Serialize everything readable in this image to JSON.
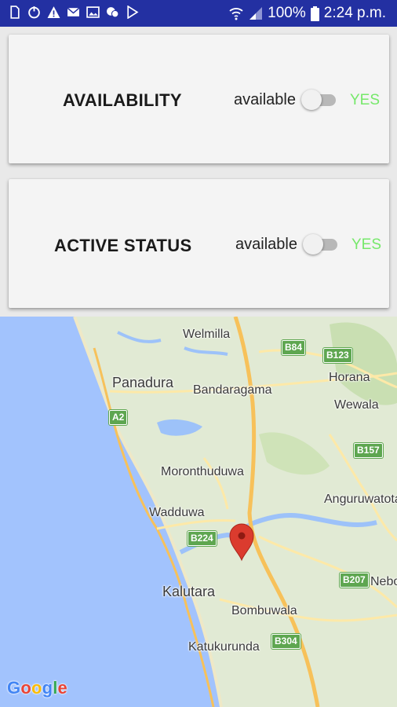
{
  "status_bar": {
    "icons": [
      "sim-card-icon",
      "power-clock-icon",
      "warning-icon",
      "mail-icon",
      "image-icon",
      "chat-icon",
      "play-store-icon"
    ],
    "battery_text": "100%",
    "time": "2:24 p.m.",
    "color": "#2330a2"
  },
  "cards": [
    {
      "title": "AVAILABILITY",
      "switch_label": "available",
      "value": "YES",
      "switch_on": false
    },
    {
      "title": "ACTIVE STATUS",
      "switch_label": "available",
      "value": "YES",
      "switch_on": false
    }
  ],
  "map": {
    "places": [
      "Welmilla",
      "Panadura",
      "Bandaragama",
      "Horana",
      "Wewala",
      "Moronthuduwa",
      "Anguruwatota",
      "Wadduwa",
      "Kalutara",
      "Bombuwala",
      "Katukurunda",
      "Nebo"
    ],
    "shields": [
      "B84",
      "B123",
      "A2",
      "B157",
      "B224",
      "B207",
      "B304"
    ],
    "attribution": "Google",
    "marker": "map-pin-icon",
    "colors": {
      "sea": "#a2c3fd",
      "land": "#e1ead4",
      "road_major": "#f7c15a",
      "road_minor": "#fde9a8",
      "water": "#9dc2f9",
      "shield": "#5ea650",
      "marker": "#db3b2e"
    }
  },
  "accent": {
    "yes_color": "#76e86a"
  }
}
